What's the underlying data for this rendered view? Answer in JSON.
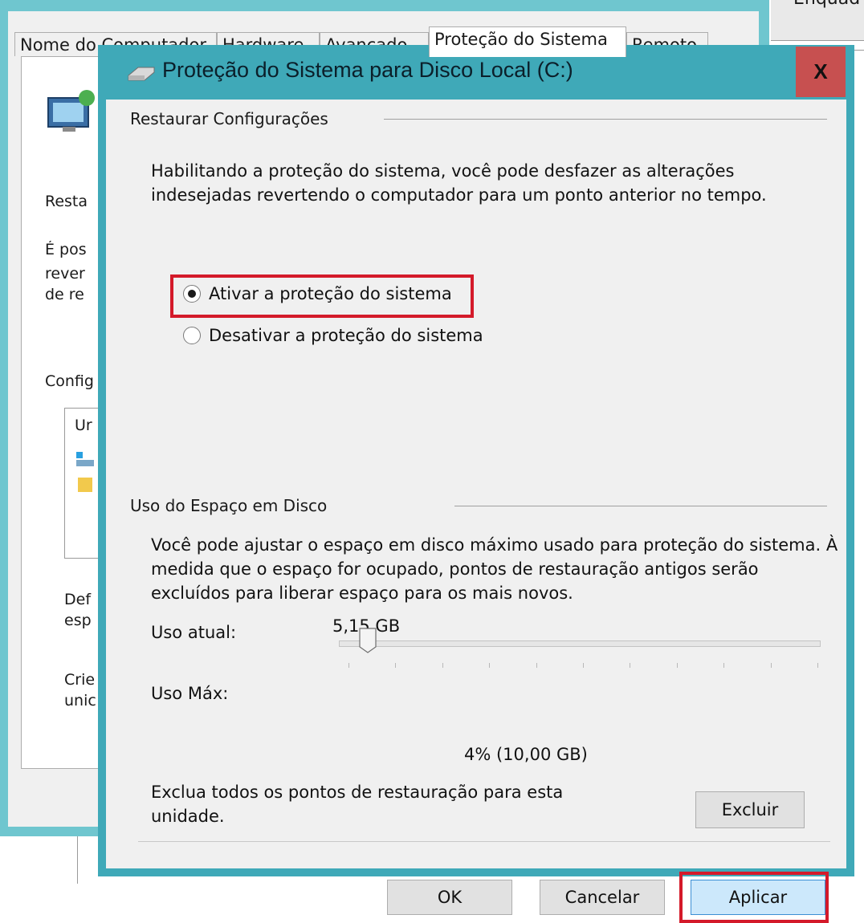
{
  "background_window": {
    "tabs": [
      "Nome do Computador",
      "Hardware",
      "Avançado",
      "Proteção do Sistema",
      "Remoto"
    ],
    "active_tab": "Proteção do Sistema",
    "fragments": {
      "restore_heading": "Resta",
      "desc_line1": "É pos",
      "desc_line2": "rever",
      "desc_line3": "de re",
      "config_heading": "Config",
      "list_header": "Ur",
      "define_line1": "Def",
      "define_line2": "esp",
      "create_line1": "Crie",
      "create_line2": "unic"
    },
    "top_right_fragment": "Enquad"
  },
  "dialog": {
    "title": "Proteção do Sistema para Disco Local (C:)",
    "close_label": "X",
    "restore_section": {
      "title": "Restaurar Configurações",
      "description": "Habilitando a proteção do sistema, você pode desfazer as alterações indesejadas revertendo o computador para um ponto anterior no tempo.",
      "options": [
        {
          "label": "Ativar a proteção do sistema",
          "checked": true
        },
        {
          "label": "Desativar a proteção do sistema",
          "checked": false
        }
      ]
    },
    "disk_section": {
      "title": "Uso do Espaço em Disco",
      "description": "Você pode ajustar o espaço em disco máximo usado para proteção do sistema. À medida que o espaço for ocupado, pontos de restauração antigos serão excluídos para liberar espaço para os mais novos.",
      "current_usage_label": "Uso atual:",
      "current_usage_value": "5,15 GB",
      "max_usage_label": "Uso Máx:",
      "max_usage_value": "4% (10,00 GB)",
      "max_usage_percent": 4,
      "delete_text": "Exclua todos os pontos de restauração para esta unidade.",
      "delete_button": "Excluir"
    },
    "buttons": {
      "ok": "OK",
      "cancel": "Cancelar",
      "apply": "Aplicar"
    },
    "colors": {
      "titlebar": "#3fa9b8",
      "close": "#c75050",
      "highlight": "#d41a2a",
      "apply_button": "#cce8fb"
    }
  }
}
